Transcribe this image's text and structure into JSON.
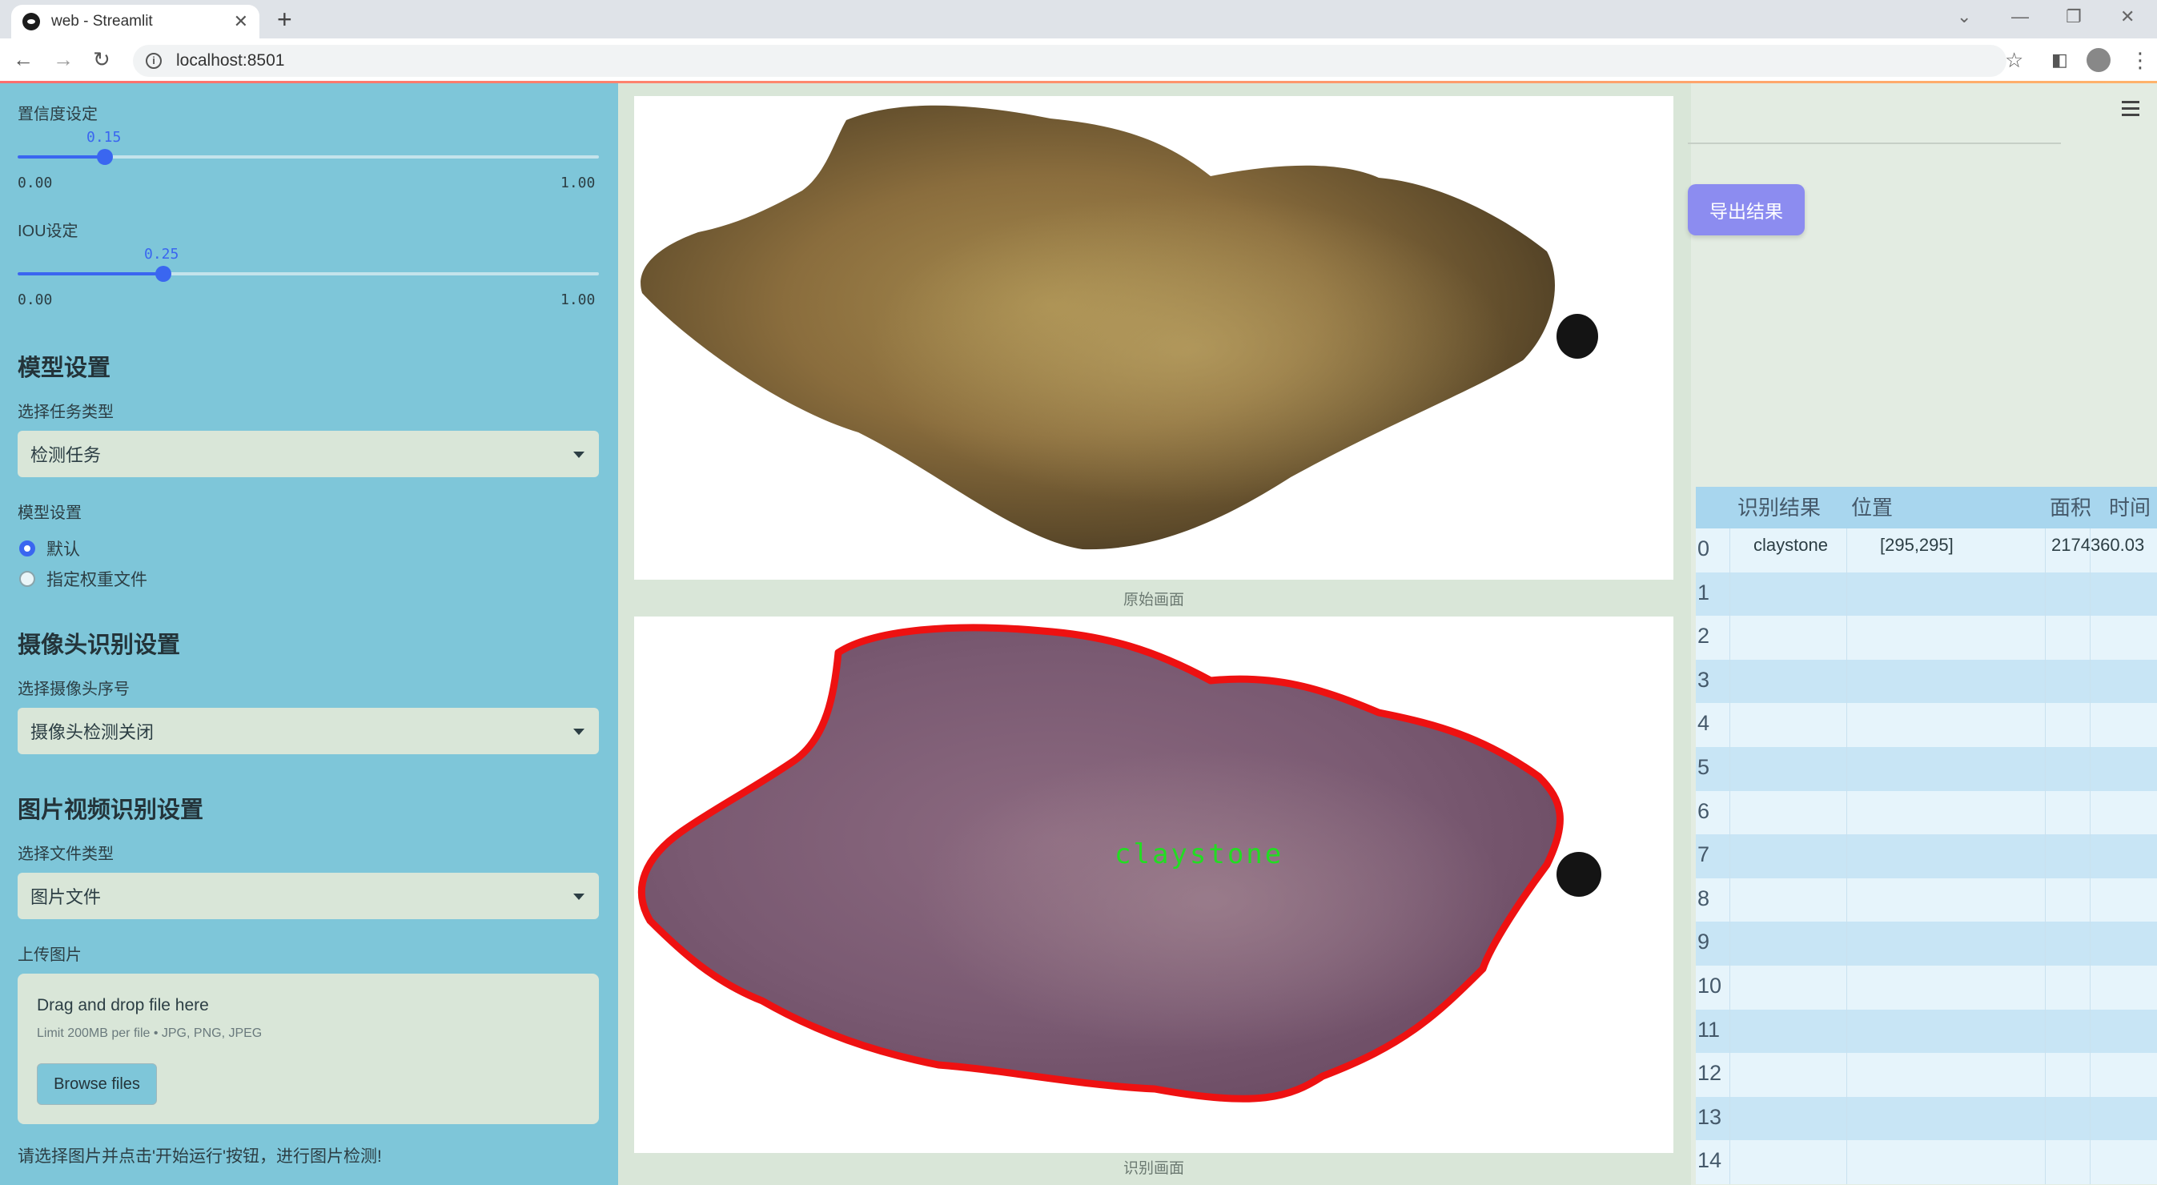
{
  "browser": {
    "tab_title": "web - Streamlit",
    "url": "localhost:8501"
  },
  "sidebar": {
    "confidence": {
      "label": "置信度设定",
      "value": "0.15",
      "min": "0.00",
      "max": "1.00",
      "fraction": 0.15
    },
    "iou": {
      "label": "IOU设定",
      "value": "0.25",
      "min": "0.00",
      "max": "1.00",
      "fraction": 0.25
    },
    "model_settings_heading": "模型设置",
    "task_type_label": "选择任务类型",
    "task_type_value": "检测任务",
    "model_label": "模型设置",
    "model_options": [
      "默认",
      "指定权重文件"
    ],
    "model_selected": "默认",
    "camera_heading": "摄像头识别设置",
    "camera_label": "选择摄像头序号",
    "camera_value": "摄像头检测关闭",
    "media_heading": "图片视频识别设置",
    "file_type_label": "选择文件类型",
    "file_type_value": "图片文件",
    "upload_label": "上传图片",
    "upload_title": "Drag and drop file here",
    "upload_limit": "Limit 200MB per file • JPG, PNG, JPEG",
    "browse_button": "Browse files",
    "hint": "请选择图片并点击'开始运行'按钮，进行图片检测!"
  },
  "main": {
    "original_caption": "原始画面",
    "result_caption": "识别画面",
    "detection_label": "claystone"
  },
  "right": {
    "export_button": "导出结果",
    "table": {
      "columns": [
        "识别结果",
        "位置",
        "面积",
        "时间"
      ],
      "rows": [
        {
          "idx": "0",
          "result": "claystone",
          "position": "[295,295]",
          "area": "2174360.03",
          "time": ""
        },
        {
          "idx": "1"
        },
        {
          "idx": "2"
        },
        {
          "idx": "3"
        },
        {
          "idx": "4"
        },
        {
          "idx": "5"
        },
        {
          "idx": "6"
        },
        {
          "idx": "7"
        },
        {
          "idx": "8"
        },
        {
          "idx": "9"
        },
        {
          "idx": "10"
        },
        {
          "idx": "11"
        },
        {
          "idx": "12"
        },
        {
          "idx": "13"
        },
        {
          "idx": "14"
        }
      ]
    }
  },
  "colors": {
    "sidebar_bg": "#7ec6d9",
    "accent": "#3a66f0",
    "export_button": "#8c8cf0",
    "detection_outline": "#ee1111",
    "detection_label": "#22dd22"
  }
}
